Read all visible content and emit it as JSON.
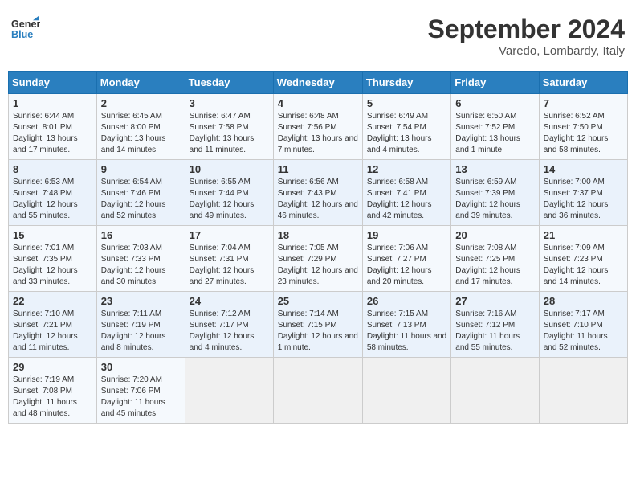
{
  "header": {
    "logo_line1": "General",
    "logo_line2": "Blue",
    "month_title": "September 2024",
    "location": "Varedo, Lombardy, Italy"
  },
  "columns": [
    "Sunday",
    "Monday",
    "Tuesday",
    "Wednesday",
    "Thursday",
    "Friday",
    "Saturday"
  ],
  "weeks": [
    [
      {
        "day": "1",
        "sunrise": "6:44 AM",
        "sunset": "8:01 PM",
        "daylight": "13 hours and 17 minutes."
      },
      {
        "day": "2",
        "sunrise": "6:45 AM",
        "sunset": "8:00 PM",
        "daylight": "13 hours and 14 minutes."
      },
      {
        "day": "3",
        "sunrise": "6:47 AM",
        "sunset": "7:58 PM",
        "daylight": "13 hours and 11 minutes."
      },
      {
        "day": "4",
        "sunrise": "6:48 AM",
        "sunset": "7:56 PM",
        "daylight": "13 hours and 7 minutes."
      },
      {
        "day": "5",
        "sunrise": "6:49 AM",
        "sunset": "7:54 PM",
        "daylight": "13 hours and 4 minutes."
      },
      {
        "day": "6",
        "sunrise": "6:50 AM",
        "sunset": "7:52 PM",
        "daylight": "13 hours and 1 minute."
      },
      {
        "day": "7",
        "sunrise": "6:52 AM",
        "sunset": "7:50 PM",
        "daylight": "12 hours and 58 minutes."
      }
    ],
    [
      {
        "day": "8",
        "sunrise": "6:53 AM",
        "sunset": "7:48 PM",
        "daylight": "12 hours and 55 minutes."
      },
      {
        "day": "9",
        "sunrise": "6:54 AM",
        "sunset": "7:46 PM",
        "daylight": "12 hours and 52 minutes."
      },
      {
        "day": "10",
        "sunrise": "6:55 AM",
        "sunset": "7:44 PM",
        "daylight": "12 hours and 49 minutes."
      },
      {
        "day": "11",
        "sunrise": "6:56 AM",
        "sunset": "7:43 PM",
        "daylight": "12 hours and 46 minutes."
      },
      {
        "day": "12",
        "sunrise": "6:58 AM",
        "sunset": "7:41 PM",
        "daylight": "12 hours and 42 minutes."
      },
      {
        "day": "13",
        "sunrise": "6:59 AM",
        "sunset": "7:39 PM",
        "daylight": "12 hours and 39 minutes."
      },
      {
        "day": "14",
        "sunrise": "7:00 AM",
        "sunset": "7:37 PM",
        "daylight": "12 hours and 36 minutes."
      }
    ],
    [
      {
        "day": "15",
        "sunrise": "7:01 AM",
        "sunset": "7:35 PM",
        "daylight": "12 hours and 33 minutes."
      },
      {
        "day": "16",
        "sunrise": "7:03 AM",
        "sunset": "7:33 PM",
        "daylight": "12 hours and 30 minutes."
      },
      {
        "day": "17",
        "sunrise": "7:04 AM",
        "sunset": "7:31 PM",
        "daylight": "12 hours and 27 minutes."
      },
      {
        "day": "18",
        "sunrise": "7:05 AM",
        "sunset": "7:29 PM",
        "daylight": "12 hours and 23 minutes."
      },
      {
        "day": "19",
        "sunrise": "7:06 AM",
        "sunset": "7:27 PM",
        "daylight": "12 hours and 20 minutes."
      },
      {
        "day": "20",
        "sunrise": "7:08 AM",
        "sunset": "7:25 PM",
        "daylight": "12 hours and 17 minutes."
      },
      {
        "day": "21",
        "sunrise": "7:09 AM",
        "sunset": "7:23 PM",
        "daylight": "12 hours and 14 minutes."
      }
    ],
    [
      {
        "day": "22",
        "sunrise": "7:10 AM",
        "sunset": "7:21 PM",
        "daylight": "12 hours and 11 minutes."
      },
      {
        "day": "23",
        "sunrise": "7:11 AM",
        "sunset": "7:19 PM",
        "daylight": "12 hours and 8 minutes."
      },
      {
        "day": "24",
        "sunrise": "7:12 AM",
        "sunset": "7:17 PM",
        "daylight": "12 hours and 4 minutes."
      },
      {
        "day": "25",
        "sunrise": "7:14 AM",
        "sunset": "7:15 PM",
        "daylight": "12 hours and 1 minute."
      },
      {
        "day": "26",
        "sunrise": "7:15 AM",
        "sunset": "7:13 PM",
        "daylight": "11 hours and 58 minutes."
      },
      {
        "day": "27",
        "sunrise": "7:16 AM",
        "sunset": "7:12 PM",
        "daylight": "11 hours and 55 minutes."
      },
      {
        "day": "28",
        "sunrise": "7:17 AM",
        "sunset": "7:10 PM",
        "daylight": "11 hours and 52 minutes."
      }
    ],
    [
      {
        "day": "29",
        "sunrise": "7:19 AM",
        "sunset": "7:08 PM",
        "daylight": "11 hours and 48 minutes."
      },
      {
        "day": "30",
        "sunrise": "7:20 AM",
        "sunset": "7:06 PM",
        "daylight": "11 hours and 45 minutes."
      },
      null,
      null,
      null,
      null,
      null
    ]
  ]
}
